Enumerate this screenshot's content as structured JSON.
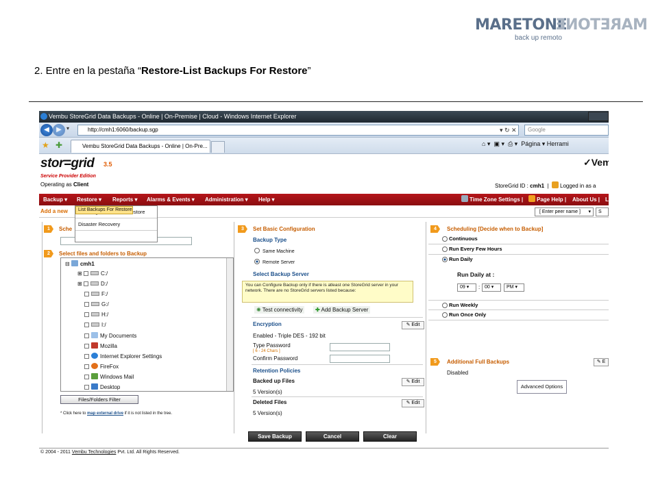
{
  "logo": {
    "main": "MARETONE",
    "mirror": "MARETONE",
    "subtitle": "back up remoto"
  },
  "instruction": {
    "prefix": "2. Entre en la pestaña “",
    "bold": "Restore-List Backups For Restore",
    "suffix": "”"
  },
  "browser": {
    "title": "Vembu StoreGrid Data Backups - Online | On-Premise | Cloud - Windows Internet Explorer",
    "url": "http://cmh1:6060/backup.sgp",
    "search_placeholder": "Google",
    "tab_title": "Vembu StoreGrid Data Backups - Online | On-Pre...",
    "tools": "Página ▾  Herrami"
  },
  "app": {
    "logo_text": "stor=grid",
    "version": "3.5",
    "brand": "Vem",
    "edition": "Service Provider Edition",
    "operating_as": {
      "label": "Operating as ",
      "value": "Client"
    },
    "storegrid_id": {
      "label": "StoreGrid ID : ",
      "value": "cmh1",
      "logged": "Logged in as a"
    },
    "menu": [
      "Backup ▾",
      "Restore ▾",
      "Reports ▾",
      "Alarms & Events ▾",
      "Administration ▾",
      "Help ▾"
    ],
    "menu_right": {
      "timezone": "Time Zone Settings",
      "page_help": "Page Help",
      "about": "About Us",
      "extra": "L"
    },
    "add_new": "Add a new",
    "peer_select": "[ Enter peer name ]",
    "peer_extra": "S",
    "restore_dropdown": [
      "List Backups For Restore",
      "Exchange Mail Level Restore",
      "Disaster Recovery"
    ],
    "step1": {
      "num": "1",
      "title": "Sche"
    },
    "step2": {
      "num": "2",
      "title": "Select files and folders to Backup"
    },
    "tree": {
      "root": "cmh1",
      "items": [
        "C:/",
        "D:/",
        "F:/",
        "G:/",
        "H:/",
        "I:/",
        "My Documents",
        "Mozilla",
        "Internet Explorer Settings",
        "FireFox",
        "Windows Mail",
        "Desktop"
      ]
    },
    "files_filter": "Files/Folders Filter",
    "map_note": {
      "prefix": "* Click here to ",
      "link": "map external drive",
      "suffix": " if it is not listed in the tree."
    },
    "step3": {
      "num": "3",
      "title": "Set Basic Configuration"
    },
    "backup_type": {
      "title": "Backup Type",
      "options": [
        "Same Machine",
        "Remote Server"
      ],
      "selected": 1
    },
    "select_server": {
      "title": "Select Backup Server",
      "warning": "You can Configure Backup only if there is atleast one StoreGrid server in your network. There are no StoreGrid servers listed because:",
      "test": "Test connectivity",
      "add": "Add Backup Server"
    },
    "encryption": {
      "title": "Encryption",
      "edit": "Edit",
      "status": "Enabled  -  Triple DES  -  192  bit",
      "type_password": "Type Password",
      "chars": "[ 6 - 24 Chars ]",
      "confirm_password": "Confirm Password"
    },
    "retention": {
      "title": "Retention Policies",
      "backed_up": {
        "label": "Backed up Files",
        "edit": "Edit",
        "value": "5  Version(s)"
      },
      "deleted": {
        "label": "Deleted Files",
        "edit": "Edit",
        "value": "5  Version(s)"
      }
    },
    "step4": {
      "num": "4",
      "title": "Scheduling [Decide when to Backup]"
    },
    "schedule": {
      "options": [
        "Continuous",
        "Run Every Few Hours",
        "Run Daily"
      ],
      "selected": 2,
      "run_daily_at": "Run Daily at :",
      "hour": "09",
      "minute": "00",
      "ampm": "PM",
      "more_options": [
        "Run Weekly",
        "Run Once Only"
      ]
    },
    "step5": {
      "num": "5",
      "title": "Additional Full Backups",
      "edit": "E",
      "status": "Disabled",
      "advanced": "Advanced Options"
    },
    "buttons": {
      "save": "Save Backup",
      "cancel": "Cancel",
      "clear": "Clear"
    },
    "footer": {
      "prefix": "© 2004 - 2011 ",
      "link": "Vembu Technologies",
      "suffix": " Pvt. Ltd. All Rights Reserved."
    }
  },
  "colors": {
    "menu_red": "#a01014",
    "accent_orange": "#f19a1c",
    "heading_blue": "#1b4f8a"
  }
}
